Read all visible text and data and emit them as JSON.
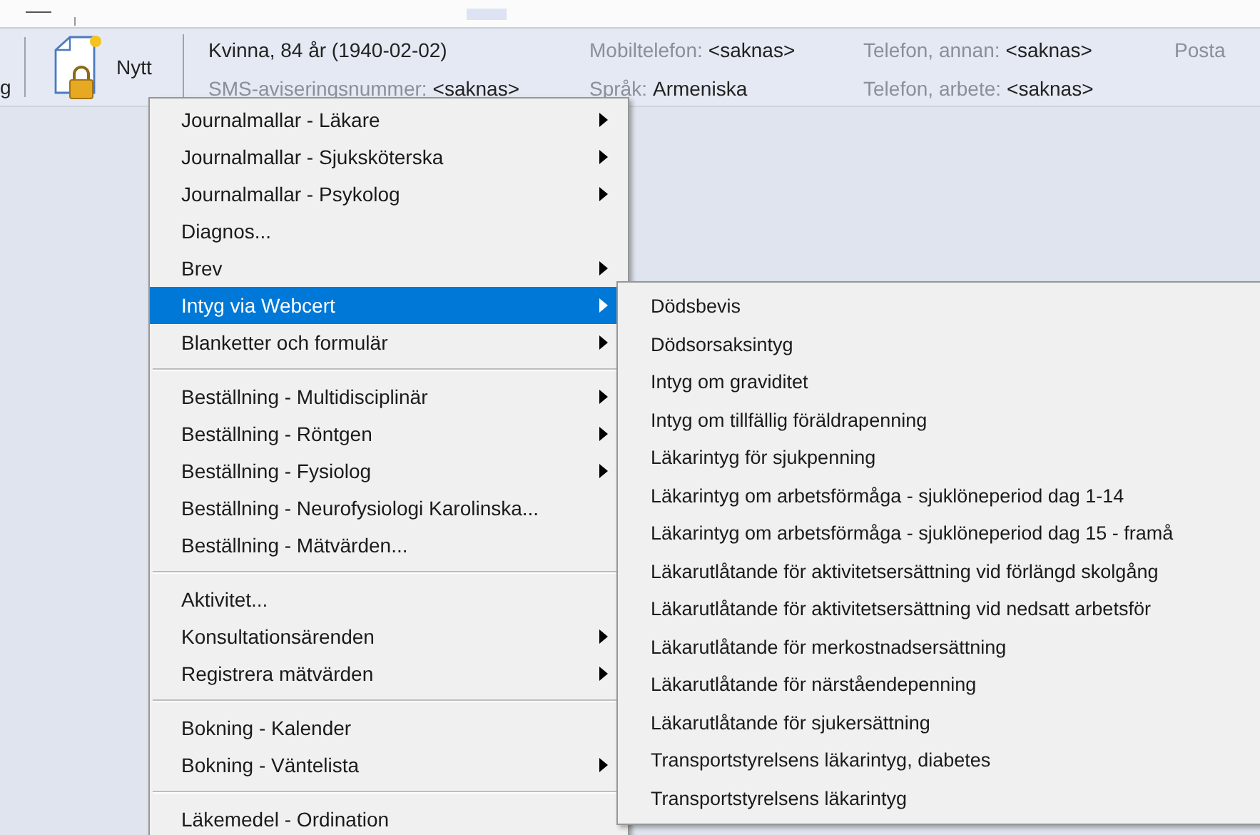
{
  "toolbar": {
    "cut_label": "g",
    "new_button": {
      "label": "Nytt"
    }
  },
  "patient": {
    "summary": "Kvinna, 84 år (1940-02-02)",
    "columns": [
      {
        "fields": [
          {
            "label": "SMS-aviseringsnummer:",
            "value": "<saknas>"
          }
        ]
      },
      {
        "fields": [
          {
            "label": "Mobiltelefon:",
            "value": "<saknas>"
          },
          {
            "label": "Språk:",
            "value": "Armeniska"
          }
        ]
      },
      {
        "fields": [
          {
            "label": "Telefon, annan:",
            "value": "<saknas>"
          },
          {
            "label": "Telefon, arbete:",
            "value": "<saknas>"
          }
        ]
      },
      {
        "fields": [
          {
            "label": "Posta"
          }
        ]
      }
    ]
  },
  "menu": {
    "groups": [
      {
        "items": [
          {
            "label": "Journalmallar - Läkare",
            "submenu": true,
            "selected": false
          },
          {
            "label": "Journalmallar - Sjuksköterska",
            "submenu": true,
            "selected": false
          },
          {
            "label": "Journalmallar - Psykolog",
            "submenu": true,
            "selected": false
          },
          {
            "label": "Diagnos...",
            "submenu": false,
            "selected": false
          },
          {
            "label": "Brev",
            "submenu": true,
            "selected": false
          },
          {
            "label": "Intyg via Webcert",
            "submenu": true,
            "selected": true
          },
          {
            "label": "Blanketter och formulär",
            "submenu": true,
            "selected": false
          }
        ]
      },
      {
        "items": [
          {
            "label": "Beställning - Multidisciplinär",
            "submenu": true,
            "selected": false
          },
          {
            "label": "Beställning - Röntgen",
            "submenu": true,
            "selected": false
          },
          {
            "label": "Beställning - Fysiolog",
            "submenu": true,
            "selected": false
          },
          {
            "label": "Beställning - Neurofysiologi Karolinska...",
            "submenu": false,
            "selected": false
          },
          {
            "label": "Beställning - Mätvärden...",
            "submenu": false,
            "selected": false
          }
        ]
      },
      {
        "items": [
          {
            "label": "Aktivitet...",
            "submenu": false,
            "selected": false
          },
          {
            "label": "Konsultationsärenden",
            "submenu": true,
            "selected": false
          },
          {
            "label": "Registrera mätvärden",
            "submenu": true,
            "selected": false
          }
        ]
      },
      {
        "items": [
          {
            "label": "Bokning - Kalender",
            "submenu": false,
            "selected": false
          },
          {
            "label": "Bokning - Väntelista",
            "submenu": true,
            "selected": false
          }
        ]
      },
      {
        "items": [
          {
            "label": "Läkemedel - Ordination",
            "selected": false
          }
        ]
      }
    ]
  },
  "submenu": {
    "items": [
      {
        "label": "Dödsbevis"
      },
      {
        "label": "Dödsorsaksintyg"
      },
      {
        "label": "Intyg om graviditet"
      },
      {
        "label": "Intyg om tillfällig föräldrapenning"
      },
      {
        "label": "Läkarintyg för sjukpenning"
      },
      {
        "label": "Läkarintyg om arbetsförmåga - sjuklöneperiod dag 1-14"
      },
      {
        "label": "Läkarintyg om arbetsförmåga - sjuklöneperiod dag 15 - framå"
      },
      {
        "label": "Läkarutlåtande för aktivitetsersättning vid förlängd skolgång"
      },
      {
        "label": "Läkarutlåtande för aktivitetsersättning vid nedsatt arbetsför"
      },
      {
        "label": "Läkarutlåtande för merkostnadsersättning"
      },
      {
        "label": "Läkarutlåtande för närståendepenning"
      },
      {
        "label": "Läkarutlåtande för sjukersättning"
      },
      {
        "label": "Transportstyrelsens läkarintyg, diabetes"
      },
      {
        "label": "Transportstyrelsens läkarintyg"
      }
    ]
  }
}
